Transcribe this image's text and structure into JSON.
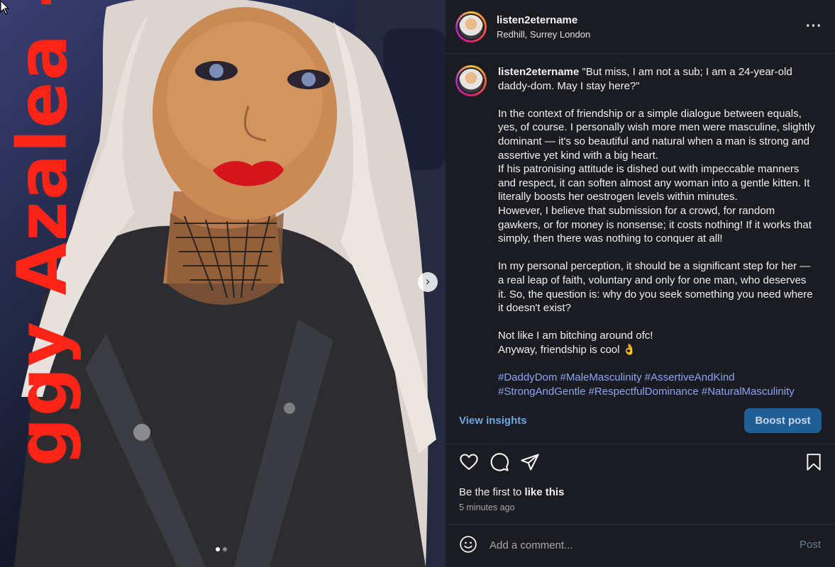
{
  "media": {
    "overlay_text": "ggy Azalea - Sav",
    "carousel_total": 2,
    "carousel_active": 1
  },
  "header": {
    "username": "listen2etername",
    "location": "Redhill, Surrey London",
    "more_icon": "more-horizontal-icon"
  },
  "caption": {
    "username": "listen2etername",
    "paragraphs": [
      [
        "\"But miss, I am not a sub; I am a 24-year-old daddy-dom. May I stay here?\""
      ],
      [
        "In the context of friendship or a simple dialogue between equals, yes, of course. I personally wish more men were masculine, slightly dominant — it's so beautiful and natural when a man is strong and assertive yet kind with a big heart.",
        "If his patronising attitude is dished out with impeccable manners and respect, it can soften almost any woman into a gentle kitten. It literally boosts her oestrogen levels within minutes.",
        "However, I believe that submission for a crowd, for random gawkers, or for money is nonsense; it costs nothing! If it works that simply, then there was nothing to conquer at all!"
      ],
      [
        "In my personal perception, it should be a significant step for her — a real leap of faith, voluntary and only for one man, who deserves it. So, the question is: why do you seek something you need where it doesn't exist?"
      ],
      [
        "Not like I am bitching around ofc!",
        "Anyway, friendship is cool 👌"
      ]
    ],
    "hashtags": [
      "#DaddyDom",
      "#MaleMasculinity",
      "#AssertiveAndKind",
      "#StrongAndGentle",
      "#RespectfulDominance",
      "#NaturalMasculinity"
    ]
  },
  "insights": {
    "view_insights_label": "View insights",
    "boost_label": "Boost post"
  },
  "actions": {
    "like_icon": "heart-icon",
    "comment_icon": "comment-bubble-icon",
    "share_icon": "paper-plane-icon",
    "save_icon": "bookmark-icon"
  },
  "likes": {
    "prefix": "Be the first to",
    "bold": "like this"
  },
  "timestamp": "5 minutes ago",
  "comment": {
    "placeholder": "Add a comment...",
    "post_label": "Post",
    "emoji_icon": "smiley-icon"
  },
  "colors": {
    "panel_bg": "#1b1c22",
    "link": "#6ba6e8",
    "hashtag": "#8ba4f5",
    "boost_bg": "#1f5f96",
    "overlay_text": "#ff2418"
  }
}
